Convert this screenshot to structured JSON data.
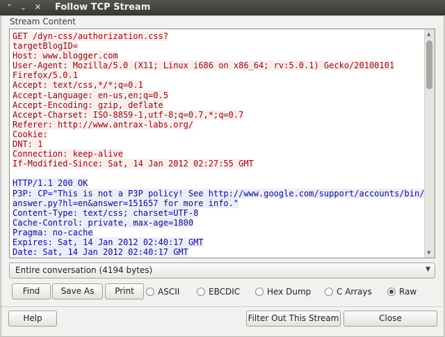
{
  "window": {
    "title": "Follow TCP Stream",
    "controls": [
      "chevron-up",
      "chevron-down",
      "close"
    ]
  },
  "stream": {
    "label": "Stream Content",
    "client_lines": [
      "GET /dyn-css/authorization.css?",
      "targetBlogID=",
      "Host: www.blogger.com",
      "User-Agent: Mozilla/5.0 (X11; Linux i686 on x86_64; rv:5.0.1) Gecko/20100101",
      "Firefox/5.0.1",
      "Accept: text/css,*/*;q=0.1",
      "Accept-Language: en-us,en;q=0.5",
      "Accept-Encoding: gzip, deflate",
      "Accept-Charset: ISO-8859-1,utf-8;q=0.7,*;q=0.7",
      "Referer: http://www.antrax-labs.org/",
      "Cookie:",
      "DNT: 1",
      "Connection: keep-alive",
      "If-Modified-Since: Sat, 14 Jan 2012 02:27:55 GMT"
    ],
    "server_lines": [
      "HTTP/1.1 200 OK",
      "P3P: CP=\"This is not a P3P policy! See http://www.google.com/support/accounts/bin/",
      "answer.py?hl=en&answer=151657 for more info.\"",
      "Content-Type: text/css; charset=UTF-8",
      "Cache-Control: private, max-age=1800",
      "Pragma: no-cache",
      "Expires: Sat, 14 Jan 2012 02:40:17 GMT",
      "Date: Sat, 14 Jan 2012 02:40:17 GMT"
    ],
    "colors": {
      "client_text": "#8a0d0d",
      "client_bg": "#fbeded",
      "server_text": "#0d0d8a",
      "server_bg": "#ececfb"
    }
  },
  "conversation_select": {
    "value": "Entire conversation (4194 bytes)"
  },
  "actions": {
    "find": "Find",
    "save_as": "Save As",
    "print": "Print"
  },
  "format": {
    "options": [
      "ASCII",
      "EBCDIC",
      "Hex Dump",
      "C Arrays",
      "Raw"
    ],
    "selected": "Raw"
  },
  "footer": {
    "help": "Help",
    "filter_out": "Filter Out This Stream",
    "close": "Close"
  }
}
